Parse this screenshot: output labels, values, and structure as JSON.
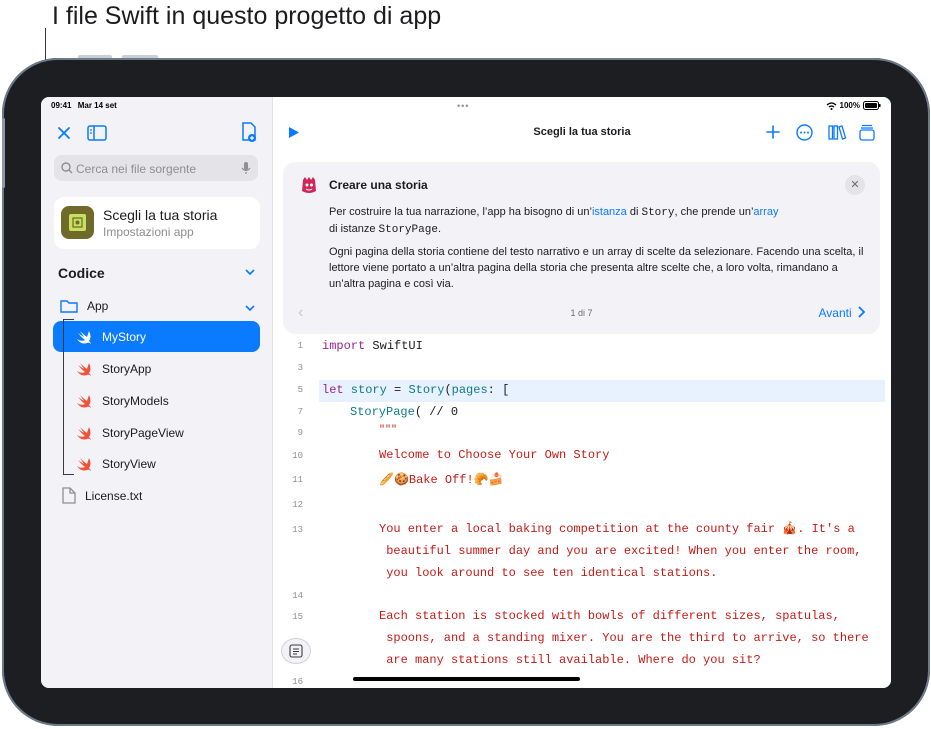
{
  "callout": {
    "text": "I file Swift in questo progetto di app"
  },
  "status": {
    "time": "09:41",
    "date": "Mar 14 set",
    "battery": "100%"
  },
  "sidebar": {
    "search_placeholder": "Cerca nei file sorgente",
    "card": {
      "title": "Scegli la tua storia",
      "subtitle": "Impostazioni app"
    },
    "section_title": "Codice",
    "folder": "App",
    "files": [
      {
        "label": "MyStory",
        "selected": true
      },
      {
        "label": "StoryApp",
        "selected": false
      },
      {
        "label": "StoryModels",
        "selected": false
      },
      {
        "label": "StoryPageView",
        "selected": false
      },
      {
        "label": "StoryView",
        "selected": false
      }
    ],
    "license": "License.txt"
  },
  "main": {
    "title": "Scegli la tua storia",
    "info": {
      "heading": "Creare una storia",
      "p1_a": "Per costruire la tua narrazione, l’app ha bisogno di un’",
      "p1_link1": "istanza",
      "p1_b": " di ",
      "p1_code1": "Story",
      "p1_c": ", che prende un’",
      "p1_link2": "array",
      "p1_d": "di istanze ",
      "p1_code2": "StoryPage",
      "p1_e": ".",
      "p2": "Ogni pagina della storia contiene del testo narrativo e un array di scelte da selezionare. Facendo una scelta, il lettore viene portato a un’altra pagina della storia che presenta altre scelte che, a loro volta, rimandano a un’altra pagina e così via.",
      "pager": "1 di 7",
      "next": "Avanti"
    },
    "code": {
      "line_numbers": [
        "1",
        "3",
        "5",
        "7",
        "9",
        "10",
        "11",
        "12",
        "13",
        "14",
        "15",
        "16"
      ],
      "l1_kw": "import",
      "l1_rest": " SwiftUI",
      "l5_kw": "let",
      "l5_var": " story",
      "l5_eq": " = ",
      "l5_type": "Story",
      "l5_open": "(",
      "l5_param": "pages",
      "l5_rest": ": [",
      "l7_type": "StoryPage",
      "l7_rest": "( // 0",
      "l9": "\"\"\"",
      "l10": "Welcome to Choose Your Own Story",
      "l11": "🥖🍪Bake Off!🥐🍰",
      "l13a": "You enter a local baking competition at the county fair 🎪. It's a",
      "l13b": " beautiful summer day and you are excited! When you enter the room,",
      "l13c": " you look around to see ten identical stations.",
      "l15a": "Each station is stocked with bowls of different sizes, spatulas,",
      "l15b": " spoons, and a standing mixer. You are the third to arrive, so there",
      "l15c": " are many stations still available. Where do you sit?"
    }
  }
}
